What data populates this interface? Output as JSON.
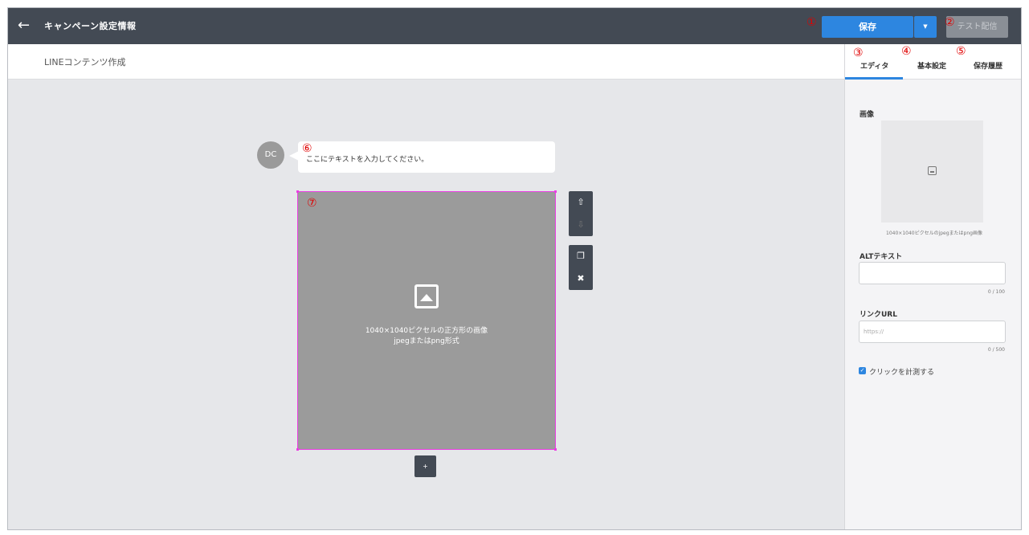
{
  "header": {
    "title": "キャンペーン設定情報",
    "save_label": "保存",
    "save_caret": "▼",
    "test_label": "テスト配信"
  },
  "subheader": {
    "title": "LINEコンテンツ作成"
  },
  "tabs": [
    {
      "label": "エディタ"
    },
    {
      "label": "基本設定"
    },
    {
      "label": "保存履歴"
    }
  ],
  "panel": {
    "image_label": "画像",
    "image_note": "1040×1040ピクセルのjpegまたはpng画像",
    "alt_label": "ALTテキスト",
    "alt_count": "0 / 100",
    "link_label": "リンクURL",
    "link_placeholder": "https://",
    "link_count": "0 / 500",
    "click_label": "クリックを計測する"
  },
  "message": {
    "avatar_text": "DC",
    "bubble_text": "ここにテキストを入力してください。"
  },
  "image_block": {
    "line1": "1040×1040ピクセルの正方形の画像",
    "line2": "jpegまたはpng形式"
  },
  "add_label": "+",
  "markers": [
    "①",
    "②",
    "③",
    "④",
    "⑤",
    "⑥",
    "⑦"
  ],
  "colors": {
    "header_bg": "#434a54",
    "accent": "#2d86e0",
    "selection": "#ea3ee3",
    "marker": "#e00000"
  }
}
